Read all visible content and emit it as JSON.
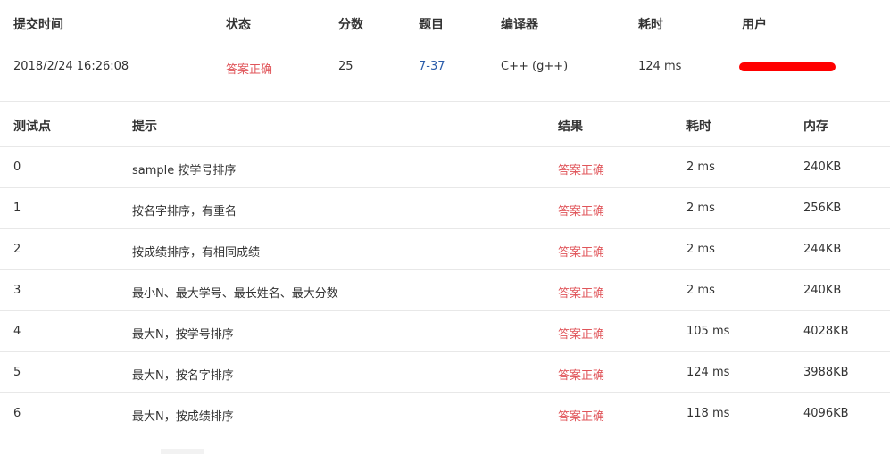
{
  "submission": {
    "headers": [
      "提交时间",
      "状态",
      "分数",
      "题目",
      "编译器",
      "耗时",
      "用户"
    ],
    "submit_time": "2018/2/24 16:26:08",
    "status": "答案正确",
    "score": "25",
    "problem": "7-37",
    "compiler": "C++ (g++)",
    "time": "124 ms"
  },
  "cases": {
    "headers": [
      "测试点",
      "提示",
      "结果",
      "耗时",
      "内存"
    ],
    "rows": [
      {
        "id": "0",
        "hint": "sample 按学号排序",
        "result": "答案正确",
        "time": "2 ms",
        "memory": "240KB"
      },
      {
        "id": "1",
        "hint": "按名字排序，有重名",
        "result": "答案正确",
        "time": "2 ms",
        "memory": "256KB"
      },
      {
        "id": "2",
        "hint": "按成绩排序，有相同成绩",
        "result": "答案正确",
        "time": "2 ms",
        "memory": "244KB"
      },
      {
        "id": "3",
        "hint": "最小N、最大学号、最长姓名、最大分数",
        "result": "答案正确",
        "time": "2 ms",
        "memory": "240KB"
      },
      {
        "id": "4",
        "hint": "最大N，按学号排序",
        "result": "答案正确",
        "time": "105 ms",
        "memory": "4028KB"
      },
      {
        "id": "5",
        "hint": "最大N，按名字排序",
        "result": "答案正确",
        "time": "124 ms",
        "memory": "3988KB"
      },
      {
        "id": "6",
        "hint": "最大N，按成绩排序",
        "result": "答案正确",
        "time": "118 ms",
        "memory": "4096KB"
      }
    ]
  },
  "colors": {
    "accepted": "#e0555a",
    "link": "#2a5caa",
    "redaction": "#ff0000"
  }
}
